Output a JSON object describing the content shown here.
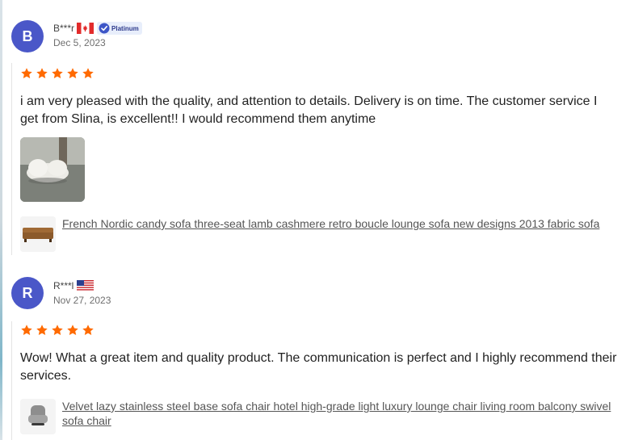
{
  "reviews": [
    {
      "avatar_letter": "B",
      "reviewer": "B***r",
      "country": "Canada",
      "badge": "Platinum",
      "date": "Dec 5, 2023",
      "rating": 5,
      "text": "i am very pleased with the quality, and attention to details. Delivery is on time. The customer service I get from Slina, is excellent!! I would recommend them anytime",
      "product": "French Nordic candy sofa three-seat lamb cashmere retro boucle lounge sofa new designs 2013 fabric sofa"
    },
    {
      "avatar_letter": "R",
      "reviewer": "R***l",
      "country": "United States",
      "date": "Nov 27, 2023",
      "rating": 5,
      "text": "Wow! What a great item and quality product. The communication is perfect and I highly recommend their services.",
      "product": "Velvet lazy stainless steel base sofa chair hotel high-grade light luxury lounge chair living room balcony swivel sofa chair"
    }
  ],
  "colors": {
    "avatar": "#4a57c8",
    "star": "#ff6a00",
    "badge_bg": "#e8eefb"
  },
  "icons": {
    "star": "star-icon",
    "badge": "platinum-badge-icon"
  }
}
